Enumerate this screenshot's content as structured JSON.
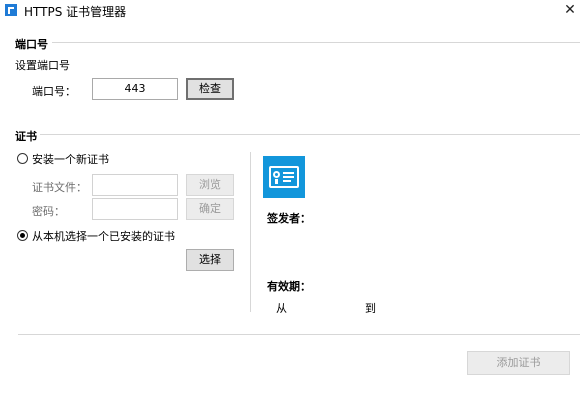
{
  "window": {
    "title": "HTTPS 证书管理器",
    "close_glyph": "✕"
  },
  "port_section": {
    "heading": "端口号",
    "subheading": "设置端口号",
    "port_label": "端口号：",
    "port_value": "443",
    "check_button": "检查"
  },
  "cert_section": {
    "heading": "证书",
    "install_new_label": "安装一个新证书",
    "install_new_selected": false,
    "cert_file_label": "证书文件：",
    "cert_file_value": "",
    "browse_button": "浏览",
    "password_label": "密码：",
    "password_value": "",
    "confirm_button": "确定",
    "choose_installed_label": "从本机选择一个已安装的证书",
    "choose_installed_selected": true,
    "select_button": "选择"
  },
  "cert_info": {
    "icon": "certificate-icon",
    "icon_color": "#1296db",
    "issuer_label": "签发者：",
    "issuer_value": "",
    "validity_label": "有效期：",
    "from_label": "从",
    "to_label": "到"
  },
  "footer": {
    "add_cert_button": "添加证书"
  }
}
